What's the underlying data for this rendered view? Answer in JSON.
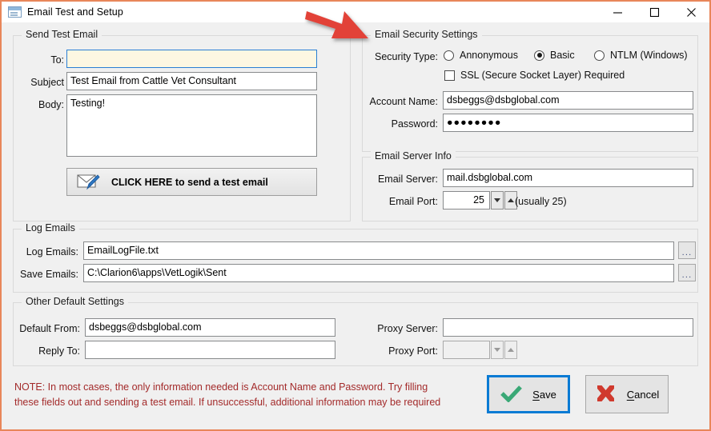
{
  "window": {
    "title": "Email Test and Setup",
    "icon": "window-app-icon",
    "controls": {
      "minimize": "minimize-icon",
      "maximize": "maximize-icon",
      "close": "close-icon"
    },
    "border_color": "#e8865a"
  },
  "annotation": {
    "arrow": "red-arrow-pointing-to-email-security-settings",
    "color": "#e04038"
  },
  "send_test_email": {
    "group_title": "Send Test Email",
    "to_label": "To:",
    "to_value": "",
    "subject_label": "Subject",
    "subject_value": "Test Email from Cattle Vet Consultant",
    "body_label": "Body:",
    "body_value": "Testing!",
    "send_button_label": "CLICK HERE to send a test email",
    "send_button_icon": "envelope-pen-icon"
  },
  "email_security": {
    "group_title": "Email Security Settings",
    "security_type_label": "Security Type:",
    "options": [
      {
        "label": "Annonymous",
        "selected": false
      },
      {
        "label": "Basic",
        "selected": true
      },
      {
        "label": "NTLM (Windows)",
        "selected": false
      }
    ],
    "ssl_label": "SSL (Secure Socket Layer) Required",
    "ssl_checked": false,
    "account_name_label": "Account Name:",
    "account_name_value": "dsbeggs@dsbglobal.com",
    "password_label": "Password:",
    "password_value": "●●●●●●●●"
  },
  "email_server": {
    "group_title": "Email Server Info",
    "server_label": "Email Server:",
    "server_value": "mail.dsbglobal.com",
    "port_label": "Email Port:",
    "port_value": "25",
    "port_hint": "(usually 25)"
  },
  "log_emails": {
    "group_title": "Log Emails",
    "log_label": "Log Emails:",
    "log_value": "EmailLogFile.txt",
    "save_label": "Save Emails:",
    "save_value": "C:\\Clarion6\\apps\\VetLogik\\Sent",
    "browse_label": "..."
  },
  "other_defaults": {
    "group_title": "Other Default Settings",
    "default_from_label": "Default From:",
    "default_from_value": "dsbeggs@dsbglobal.com",
    "reply_to_label": "Reply To:",
    "reply_to_value": "",
    "proxy_server_label": "Proxy Server:",
    "proxy_server_value": "",
    "proxy_port_label": "Proxy Port:",
    "proxy_port_value": ""
  },
  "footer": {
    "note": "NOTE: In most cases, the only information needed is Account Name and Password.  Try filling\nthese fields out and sending a test email.  If unsuccessful, additional information may be required",
    "note_color": "#a32a2a",
    "save_label_pre": "S",
    "save_label_post": "ave",
    "save_icon": "green-check-icon",
    "cancel_label_pre": "C",
    "cancel_label_post": "ancel",
    "cancel_icon": "red-x-icon"
  }
}
